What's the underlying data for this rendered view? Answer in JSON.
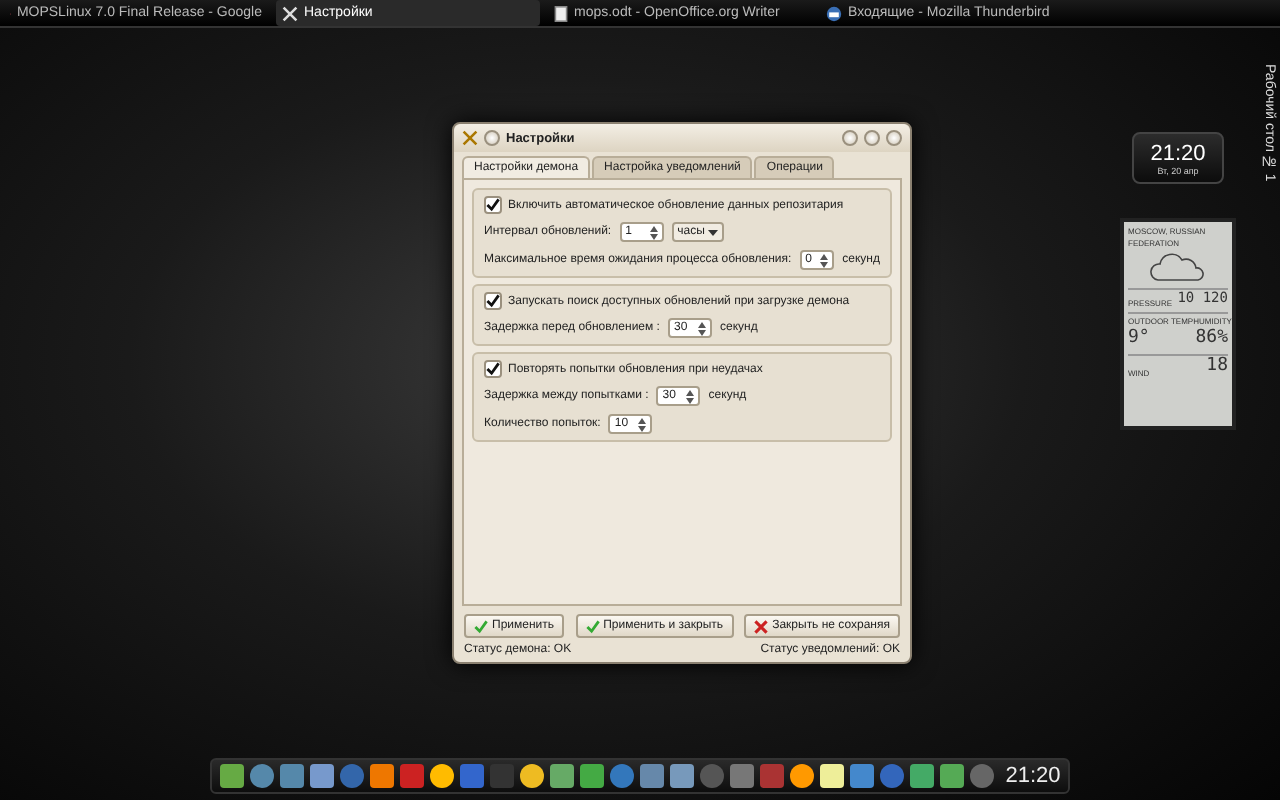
{
  "taskbar": {
    "tasks": [
      {
        "label": "MOPSLinux 7.0 Final Release - Google",
        "kind": "browser",
        "selected": false
      },
      {
        "label": "Настройки",
        "kind": "tools",
        "selected": true
      },
      {
        "label": "mops.odt - OpenOffice.org Writer",
        "kind": "document",
        "selected": false
      },
      {
        "label": "Входящие - Mozilla Thunderbird",
        "kind": "mail",
        "selected": false
      }
    ]
  },
  "dialog": {
    "title": "Настройки",
    "tabs": [
      {
        "label": "Настройки демона",
        "selected": true
      },
      {
        "label": "Настройка уведомлений",
        "selected": false
      },
      {
        "label": "Операции",
        "selected": false
      }
    ],
    "groups": [
      {
        "checkbox": {
          "label": "Включить автоматическое обновление данных репозитария",
          "checked": true
        },
        "rows": [
          {
            "kind": "spin-select",
            "label": "Интервал обновлений:",
            "value": "1",
            "unit": "часы"
          },
          {
            "kind": "spin-unit",
            "label": "Максимальное время ожидания процесса обновления:",
            "value": "0",
            "unit": "секунд"
          }
        ]
      },
      {
        "checkbox": {
          "label": "Запускать поиск доступных обновлений при загрузке демона",
          "checked": true
        },
        "rows": [
          {
            "kind": "spin-unit",
            "label": "Задержка перед обновлением :",
            "value": "30",
            "unit": "секунд"
          }
        ]
      },
      {
        "checkbox": {
          "label": "Повторять попытки обновления при неудачах",
          "checked": true
        },
        "rows": [
          {
            "kind": "spin-unit",
            "label": "Задержка между попытками :",
            "value": "30",
            "unit": "секунд"
          },
          {
            "kind": "spin",
            "label": "Количество попыток:",
            "value": "10"
          }
        ]
      }
    ],
    "buttons": [
      {
        "label": "Применить",
        "kind": "ok"
      },
      {
        "label": "Применить и закрыть",
        "kind": "ok"
      },
      {
        "label": "Закрыть не сохраняя",
        "kind": "cancel"
      }
    ],
    "status_left": "Статус демона: OK",
    "status_right": "Статус уведомлений: OK"
  },
  "desktop_label": "Рабочий стол № 1",
  "clock_widget": {
    "time": "21:20",
    "date": "Вт, 20 апр"
  },
  "weather": {
    "location": "MOSCOW, RUSSIAN FEDERATION",
    "pressure_label": "PRESSURE",
    "pressure": "10 120",
    "temp_label": "OUTDOOR TEMP",
    "humidity_label": "HUMIDITY",
    "temp": "9°",
    "humidity": "86%",
    "wind_label": "WIND",
    "wind": "18"
  },
  "dock": {
    "clock": "21:20"
  }
}
